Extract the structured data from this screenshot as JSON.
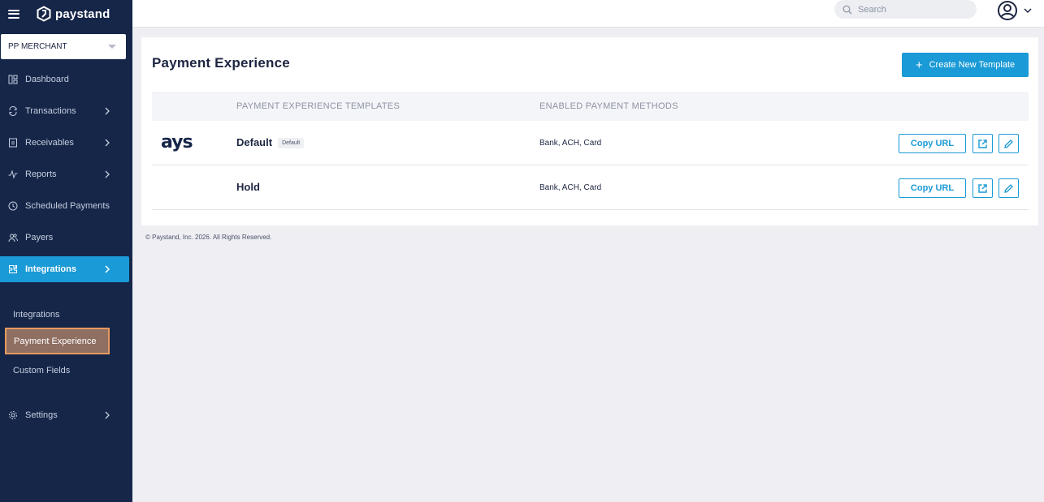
{
  "brand": {
    "name": "paystand"
  },
  "sidebar": {
    "merchant": "PP MERCHANT",
    "items": [
      {
        "label": "Dashboard",
        "icon": "dashboard-icon"
      },
      {
        "label": "Transactions",
        "icon": "transactions-icon"
      },
      {
        "label": "Receivables",
        "icon": "receivables-icon"
      },
      {
        "label": "Reports",
        "icon": "reports-icon"
      },
      {
        "label": "Scheduled Payments",
        "icon": "clock-icon"
      },
      {
        "label": "Payers",
        "icon": "payers-icon"
      },
      {
        "label": "Integrations",
        "icon": "integrations-icon"
      },
      {
        "label": "Settings",
        "icon": "gear-icon"
      }
    ],
    "sub_items": [
      "Integrations",
      "Payment Experience",
      "Custom Fields"
    ]
  },
  "topbar": {
    "search_placeholder": "Search"
  },
  "main": {
    "title": "Payment Experience",
    "create_button": "Create New Template",
    "columns": [
      "PAYMENT EXPERIENCE TEMPLATES",
      "ENABLED PAYMENT METHODS"
    ],
    "rows": [
      {
        "logo": "ays",
        "name": "Default",
        "badge": "Default",
        "methods": "Bank, ACH, Card",
        "copy_label": "Copy URL"
      },
      {
        "logo": "",
        "name": "Hold",
        "badge": "",
        "methods": "Bank, ACH, Card",
        "copy_label": "Copy URL"
      }
    ]
  },
  "footer": "© Paystand, Inc. 2026. All Rights Reserved.",
  "colors": {
    "sidebar": "#152649",
    "accent": "#1a9ad6",
    "highlight": "#e89a5e"
  }
}
